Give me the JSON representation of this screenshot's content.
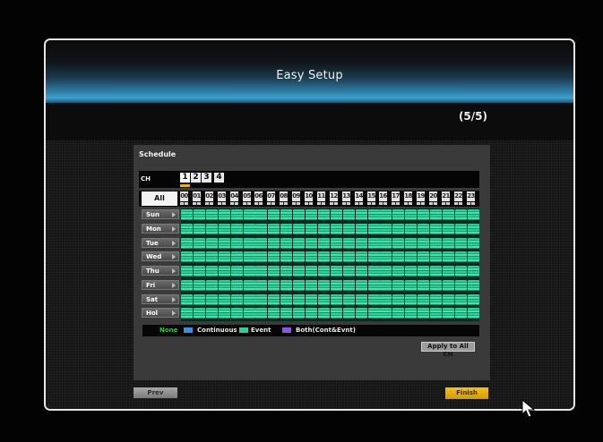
{
  "dialog": {
    "title": "Easy Setup",
    "step": "(5/5)"
  },
  "schedule": {
    "title": "Schedule",
    "ch_label": "CH",
    "channels": [
      "1",
      "2",
      "3",
      "4"
    ],
    "selected_channel": "1",
    "all_label": "All",
    "hours": [
      "00",
      "01",
      "02",
      "03",
      "04",
      "05",
      "06",
      "07",
      "08",
      "09",
      "10",
      "11",
      "12",
      "13",
      "14",
      "15",
      "16",
      "17",
      "18",
      "19",
      "20",
      "21",
      "22",
      "23"
    ],
    "days": [
      "Sun",
      "Mon",
      "Tue",
      "Wed",
      "Thu",
      "Fri",
      "Sat",
      "Hol"
    ],
    "cell_state": "Event",
    "legend": [
      {
        "label": "None",
        "color": "#22cc33"
      },
      {
        "label": "Continuous",
        "color": "#3a8fe0"
      },
      {
        "label": "Event",
        "color": "#2fce99"
      },
      {
        "label": "Both(Cont&Evnt)",
        "color": "#8a55e0"
      }
    ],
    "apply_all_label": "Apply to All CH"
  },
  "footer": {
    "prev_label": "Prev",
    "finish_label": "Finish"
  },
  "colors": {
    "accent": "#2e7ea4",
    "event": "#2fce99",
    "finish": "#e8b400"
  }
}
